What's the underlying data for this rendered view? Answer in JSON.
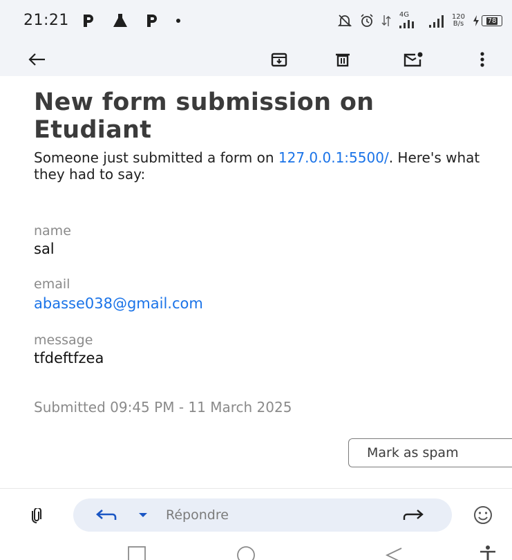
{
  "status_bar": {
    "time": "21:21",
    "network_label": "4G",
    "speed_value": "120",
    "speed_unit": "B/s",
    "battery": "78"
  },
  "toolbar": {
    "icons": [
      "back-arrow-icon",
      "archive-icon",
      "delete-icon",
      "mark-unread-icon",
      "more-vert-icon"
    ]
  },
  "email": {
    "title": "New form submission on Etudiant",
    "intro_before": "Someone just submitted a form on ",
    "intro_link": "127.0.0.1:5500/",
    "intro_after": ". Here's what they had to say:",
    "fields": [
      {
        "label": "name",
        "value": "sal"
      },
      {
        "label": "email",
        "value": "abasse038@gmail.com"
      },
      {
        "label": "message",
        "value": "tfdeftfzea"
      }
    ],
    "submitted": "Submitted 09:45 PM - 11 March 2025",
    "spam_button": "Mark as spam"
  },
  "reply_bar": {
    "placeholder": "Répondre"
  },
  "colors": {
    "link": "#1a73e8",
    "header_bg": "#f2f4f8",
    "reply_pill_bg": "#e9eef7"
  }
}
